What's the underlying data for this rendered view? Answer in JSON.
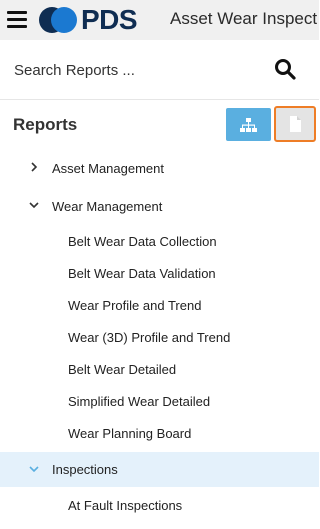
{
  "header": {
    "logo_text": "PDS",
    "app_title": "Asset Wear Inspect"
  },
  "search": {
    "placeholder": "Search Reports ..."
  },
  "reports": {
    "title": "Reports"
  },
  "tree": {
    "asset_management": "Asset Management",
    "wear_management": "Wear Management",
    "wear_children": [
      "Belt Wear Data Collection",
      "Belt Wear Data Validation",
      "Wear Profile and Trend",
      "Wear (3D) Profile and Trend",
      "Belt Wear Detailed",
      "Simplified Wear Detailed",
      "Wear Planning Board"
    ],
    "inspections": "Inspections",
    "inspection_children": [
      "At Fault Inspections"
    ]
  },
  "colors": {
    "accent": "#5aafe0",
    "focus_outline": "#ee7d26",
    "selected_row": "#e4f1fb",
    "brand_dark": "#0f2d52",
    "brand_blue": "#1b79d1"
  },
  "icons": {
    "menu": "hamburger-icon",
    "search": "search-icon",
    "hierarchy": "sitemap-icon",
    "document": "document-icon",
    "collapsed": "chevron-right-icon",
    "expanded": "chevron-down-icon"
  }
}
